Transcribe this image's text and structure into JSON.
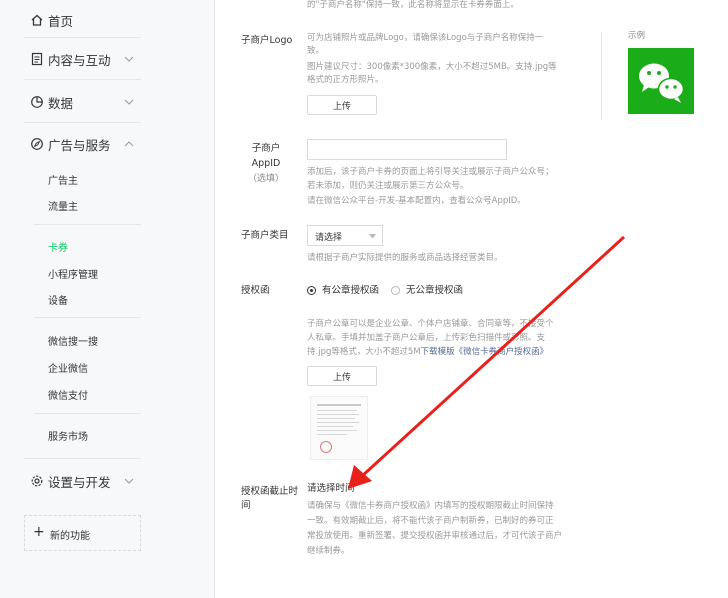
{
  "nav": {
    "home": "首页",
    "content": "内容与互动",
    "data": "数据",
    "ads": "广告与服务",
    "ads_sub_1": [
      "广告主",
      "流量主"
    ],
    "ads_sub_2": [
      "卡券",
      "小程序管理",
      "设备"
    ],
    "ads_sub_3": [
      "微信搜一搜",
      "企业微信",
      "微信支付"
    ],
    "ads_sub_4": [
      "服务市场"
    ],
    "settings": "设置与开发",
    "new_features": "新的功能"
  },
  "top_note": "的\"子商户名称\"保持一致，此名称将显示在卡券券面上。",
  "logo": {
    "label": "子商户Logo",
    "help": [
      "可为店铺照片或品牌Logo，请确保该Logo与子商户名称保持一",
      "致。",
      "图片建议尺寸：300像素*300像素，大小不超过5MB。支持.jpg等",
      "格式的正方形照片。"
    ],
    "upload": "上传",
    "example_label": "示例"
  },
  "appid": {
    "label_lines": [
      "子商户",
      "AppID",
      "（选填）"
    ],
    "value": "",
    "help": [
      "添加后，该子商户卡券的页面上将引导关注或展示子商户公众号；",
      "若未添加，则仍关注或展示第三方公众号。",
      "请在微信公众平台-开发-基本配置内，查看公众号AppID。"
    ]
  },
  "category": {
    "label": "子商户类目",
    "select": "请选择",
    "help": "请根据子商户实际提供的服务或商品选择经营类目。"
  },
  "auth": {
    "label": "授权函",
    "option_yes": "有公章授权函",
    "option_no": "无公章授权函",
    "help_lines": [
      "子商户公章可以是企业公章、个体户店铺章、合同章等，不接受个",
      "人私章。手填并加盖子商户公章后，上传彩色扫描件或彩照。支"
    ],
    "help_last": "持.jpg等格式，大小不超过5M",
    "template_link": "下载模版《微信卡券商户授权函》",
    "upload": "上传"
  },
  "expiry": {
    "label_lines": [
      "授权函截止时",
      "间"
    ],
    "picker": "请选择时间",
    "help": [
      "请确保与《微信卡券商户授权函》内填写的授权期限截止时间保持",
      "一致。有效期截止后，将不能代该子商户制新券，已制好的券可正",
      "常投放使用。重新签署、提交授权函并审核通过后，才可代该子商户",
      "继续制券。"
    ]
  },
  "colors": {
    "accent": "#07c160",
    "arrow": "#e8211a",
    "link": "#576b95"
  }
}
